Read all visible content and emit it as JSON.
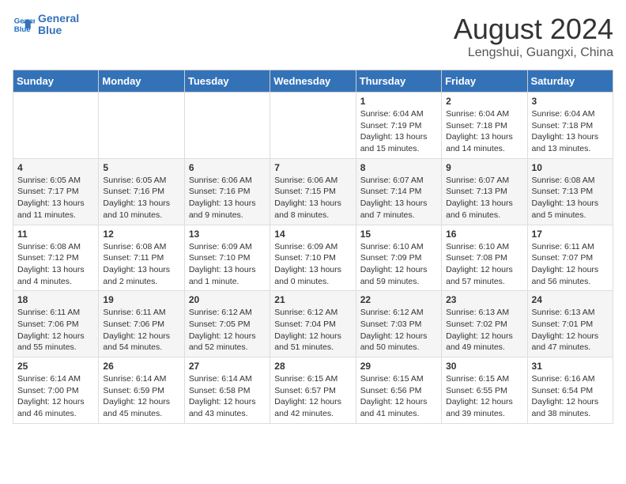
{
  "header": {
    "logo_line1": "General",
    "logo_line2": "Blue",
    "main_title": "August 2024",
    "subtitle": "Lengshui, Guangxi, China"
  },
  "days_of_week": [
    "Sunday",
    "Monday",
    "Tuesday",
    "Wednesday",
    "Thursday",
    "Friday",
    "Saturday"
  ],
  "weeks": [
    [
      {
        "day": "",
        "info": ""
      },
      {
        "day": "",
        "info": ""
      },
      {
        "day": "",
        "info": ""
      },
      {
        "day": "",
        "info": ""
      },
      {
        "day": "1",
        "info": "Sunrise: 6:04 AM\nSunset: 7:19 PM\nDaylight: 13 hours\nand 15 minutes."
      },
      {
        "day": "2",
        "info": "Sunrise: 6:04 AM\nSunset: 7:18 PM\nDaylight: 13 hours\nand 14 minutes."
      },
      {
        "day": "3",
        "info": "Sunrise: 6:04 AM\nSunset: 7:18 PM\nDaylight: 13 hours\nand 13 minutes."
      }
    ],
    [
      {
        "day": "4",
        "info": "Sunrise: 6:05 AM\nSunset: 7:17 PM\nDaylight: 13 hours\nand 11 minutes."
      },
      {
        "day": "5",
        "info": "Sunrise: 6:05 AM\nSunset: 7:16 PM\nDaylight: 13 hours\nand 10 minutes."
      },
      {
        "day": "6",
        "info": "Sunrise: 6:06 AM\nSunset: 7:16 PM\nDaylight: 13 hours\nand 9 minutes."
      },
      {
        "day": "7",
        "info": "Sunrise: 6:06 AM\nSunset: 7:15 PM\nDaylight: 13 hours\nand 8 minutes."
      },
      {
        "day": "8",
        "info": "Sunrise: 6:07 AM\nSunset: 7:14 PM\nDaylight: 13 hours\nand 7 minutes."
      },
      {
        "day": "9",
        "info": "Sunrise: 6:07 AM\nSunset: 7:13 PM\nDaylight: 13 hours\nand 6 minutes."
      },
      {
        "day": "10",
        "info": "Sunrise: 6:08 AM\nSunset: 7:13 PM\nDaylight: 13 hours\nand 5 minutes."
      }
    ],
    [
      {
        "day": "11",
        "info": "Sunrise: 6:08 AM\nSunset: 7:12 PM\nDaylight: 13 hours\nand 4 minutes."
      },
      {
        "day": "12",
        "info": "Sunrise: 6:08 AM\nSunset: 7:11 PM\nDaylight: 13 hours\nand 2 minutes."
      },
      {
        "day": "13",
        "info": "Sunrise: 6:09 AM\nSunset: 7:10 PM\nDaylight: 13 hours\nand 1 minute."
      },
      {
        "day": "14",
        "info": "Sunrise: 6:09 AM\nSunset: 7:10 PM\nDaylight: 13 hours\nand 0 minutes."
      },
      {
        "day": "15",
        "info": "Sunrise: 6:10 AM\nSunset: 7:09 PM\nDaylight: 12 hours\nand 59 minutes."
      },
      {
        "day": "16",
        "info": "Sunrise: 6:10 AM\nSunset: 7:08 PM\nDaylight: 12 hours\nand 57 minutes."
      },
      {
        "day": "17",
        "info": "Sunrise: 6:11 AM\nSunset: 7:07 PM\nDaylight: 12 hours\nand 56 minutes."
      }
    ],
    [
      {
        "day": "18",
        "info": "Sunrise: 6:11 AM\nSunset: 7:06 PM\nDaylight: 12 hours\nand 55 minutes."
      },
      {
        "day": "19",
        "info": "Sunrise: 6:11 AM\nSunset: 7:06 PM\nDaylight: 12 hours\nand 54 minutes."
      },
      {
        "day": "20",
        "info": "Sunrise: 6:12 AM\nSunset: 7:05 PM\nDaylight: 12 hours\nand 52 minutes."
      },
      {
        "day": "21",
        "info": "Sunrise: 6:12 AM\nSunset: 7:04 PM\nDaylight: 12 hours\nand 51 minutes."
      },
      {
        "day": "22",
        "info": "Sunrise: 6:12 AM\nSunset: 7:03 PM\nDaylight: 12 hours\nand 50 minutes."
      },
      {
        "day": "23",
        "info": "Sunrise: 6:13 AM\nSunset: 7:02 PM\nDaylight: 12 hours\nand 49 minutes."
      },
      {
        "day": "24",
        "info": "Sunrise: 6:13 AM\nSunset: 7:01 PM\nDaylight: 12 hours\nand 47 minutes."
      }
    ],
    [
      {
        "day": "25",
        "info": "Sunrise: 6:14 AM\nSunset: 7:00 PM\nDaylight: 12 hours\nand 46 minutes."
      },
      {
        "day": "26",
        "info": "Sunrise: 6:14 AM\nSunset: 6:59 PM\nDaylight: 12 hours\nand 45 minutes."
      },
      {
        "day": "27",
        "info": "Sunrise: 6:14 AM\nSunset: 6:58 PM\nDaylight: 12 hours\nand 43 minutes."
      },
      {
        "day": "28",
        "info": "Sunrise: 6:15 AM\nSunset: 6:57 PM\nDaylight: 12 hours\nand 42 minutes."
      },
      {
        "day": "29",
        "info": "Sunrise: 6:15 AM\nSunset: 6:56 PM\nDaylight: 12 hours\nand 41 minutes."
      },
      {
        "day": "30",
        "info": "Sunrise: 6:15 AM\nSunset: 6:55 PM\nDaylight: 12 hours\nand 39 minutes."
      },
      {
        "day": "31",
        "info": "Sunrise: 6:16 AM\nSunset: 6:54 PM\nDaylight: 12 hours\nand 38 minutes."
      }
    ]
  ]
}
